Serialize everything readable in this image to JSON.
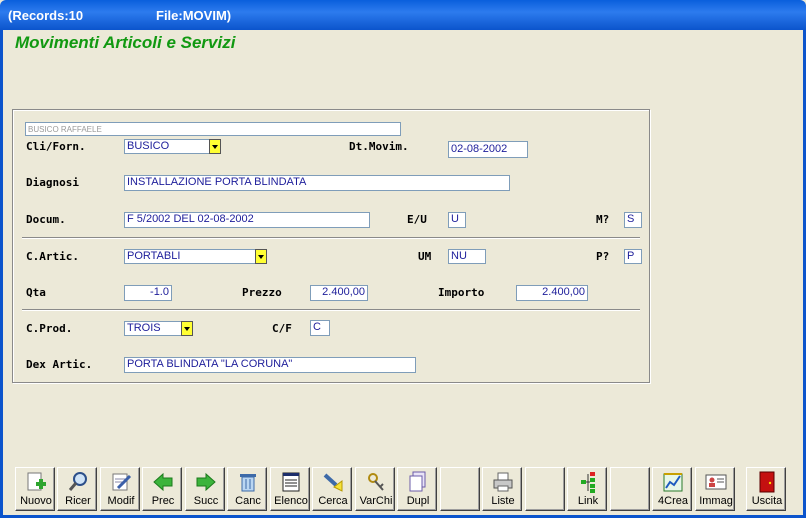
{
  "window": {
    "records": "(Records:10",
    "file": "File:MOVIM)"
  },
  "heading": "Movimenti Articoli e Servizi",
  "form": {
    "client_name": "BUSICO RAFFAELE",
    "cli_label": "Cli/Forn.",
    "cli_value": "BUSICO",
    "dt_label": "Dt.Movim.",
    "dt_value": "02-08-2002",
    "diagnosi_label": "Diagnosi",
    "diagnosi_value": "INSTALLAZIONE PORTA BLINDATA",
    "docum_label": "Docum.",
    "docum_value": "F 5/2002 DEL 02-08-2002",
    "eu_label": "E/U",
    "eu_value": "U",
    "m_label": "M?",
    "m_value": "S",
    "cartic_label": "C.Artic.",
    "cartic_value": "PORTABLI",
    "um_label": "UM",
    "um_value": "NU",
    "p_label": "P?",
    "p_value": "P",
    "qta_label": "Qta",
    "qta_value": "-1.0",
    "prezzo_label": "Prezzo",
    "prezzo_value": "2.400,00",
    "importo_label": "Importo",
    "importo_value": "2.400,00",
    "cprod_label": "C.Prod.",
    "cprod_value": "TROIS",
    "cf_label": "C/F",
    "cf_value": "C",
    "dex_label": "Dex Artic.",
    "dex_value": "PORTA BLINDATA \"LA CORUNA\""
  },
  "toolbar": [
    {
      "label": "Nuovo",
      "icon": "new-doc-icon"
    },
    {
      "label": "Ricer",
      "icon": "magnifier-icon"
    },
    {
      "label": "Modif",
      "icon": "edit-icon"
    },
    {
      "label": "Prec",
      "icon": "arrow-left-icon"
    },
    {
      "label": "Succ",
      "icon": "arrow-right-icon"
    },
    {
      "label": "Canc",
      "icon": "trash-icon"
    },
    {
      "label": "Elenco",
      "icon": "list-icon"
    },
    {
      "label": "Cerca",
      "icon": "flashlight-icon"
    },
    {
      "label": "VarChi",
      "icon": "keys-icon"
    },
    {
      "label": "Dupl",
      "icon": "duplicate-icon"
    },
    {
      "label": "",
      "icon": ""
    },
    {
      "label": "Liste",
      "icon": "printer-icon"
    },
    {
      "label": "",
      "icon": ""
    },
    {
      "label": "Link",
      "icon": "tree-icon"
    },
    {
      "label": "",
      "icon": ""
    },
    {
      "label": "4Crea",
      "icon": "chart-icon"
    },
    {
      "label": "Immag",
      "icon": "id-card-icon"
    },
    {
      "label": "",
      "icon": ""
    },
    {
      "label": "Uscita",
      "icon": "exit-door-icon"
    }
  ],
  "colors": {
    "heading": "#119911",
    "field_text": "#1d1d9a",
    "combo_button": "#ffff33",
    "titlebar": "#0a5fdc"
  }
}
